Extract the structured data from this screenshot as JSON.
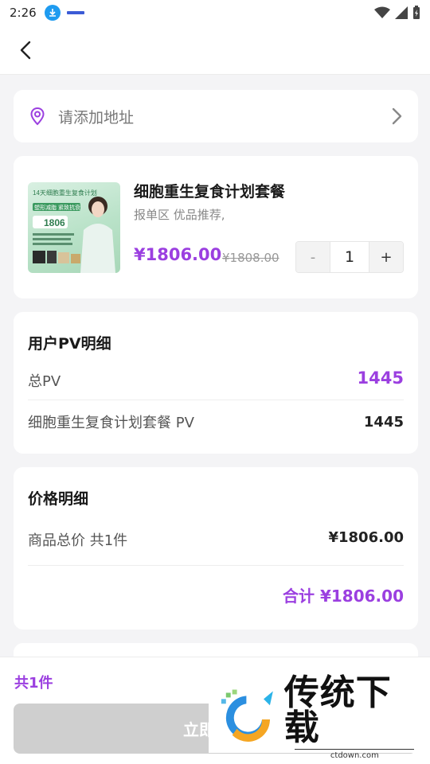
{
  "status_bar": {
    "time": "2:26"
  },
  "address": {
    "placeholder": "请添加地址"
  },
  "product": {
    "title": "细胞重生复食计划套餐",
    "subtitle": "报单区 优品推荐,",
    "price": "¥1806.00",
    "original_price": "¥1808.00",
    "quantity": "1",
    "minus_label": "-",
    "plus_label": "+",
    "image_texts": {
      "headline": "14天细胞重生复食计划",
      "tagline": "塑形减脂 紧致抗衰",
      "price_tag": "1806"
    }
  },
  "pv_detail": {
    "title": "用户PV明细",
    "total_label": "总PV",
    "total_value": "1445",
    "item_label": "细胞重生复食计划套餐 PV",
    "item_value": "1445"
  },
  "price_detail": {
    "title": "价格明细",
    "goods_label": "商品总价 共1件",
    "goods_value": "¥1806.00",
    "total_line": "合计 ¥1806.00"
  },
  "bottom_bar": {
    "count": "共1件",
    "pay_label": "立即支付"
  },
  "watermark": {
    "title": "传统下载",
    "url": "ctdown.com"
  },
  "colors": {
    "accent": "#9b3fe0",
    "pay_disabled": "#cfcfcf",
    "background": "#f4f4f6"
  }
}
